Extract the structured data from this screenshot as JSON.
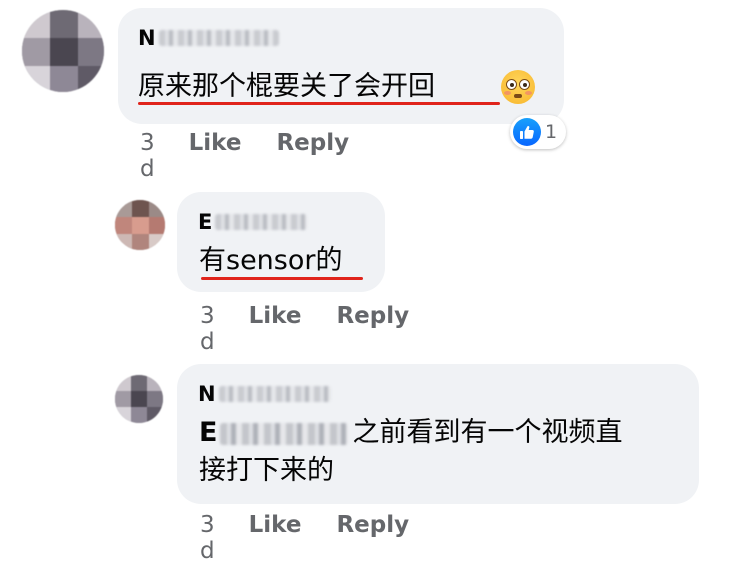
{
  "comments": [
    {
      "author_initial": "N",
      "text": "原来那个棍要关了会开回",
      "emoji": "flushed-face-emoji",
      "reaction": {
        "icon": "like-icon",
        "count": "1"
      },
      "time": "3 d",
      "like_label": "Like",
      "reply_label": "Reply"
    },
    {
      "author_initial": "E",
      "text": "有sensor的",
      "time": "3 d",
      "like_label": "Like",
      "reply_label": "Reply"
    },
    {
      "author_initial": "N",
      "mention_initial": "E",
      "text_line1": "之前看到有一个视频直",
      "text_line2": "接打下来的",
      "time": "3 d",
      "like_label": "Like",
      "reply_label": "Reply"
    }
  ],
  "colors": {
    "bubble": "#f0f2f5",
    "underline": "#e0241b",
    "like_blue": "#0866ff",
    "meta_gray": "#65676b"
  }
}
